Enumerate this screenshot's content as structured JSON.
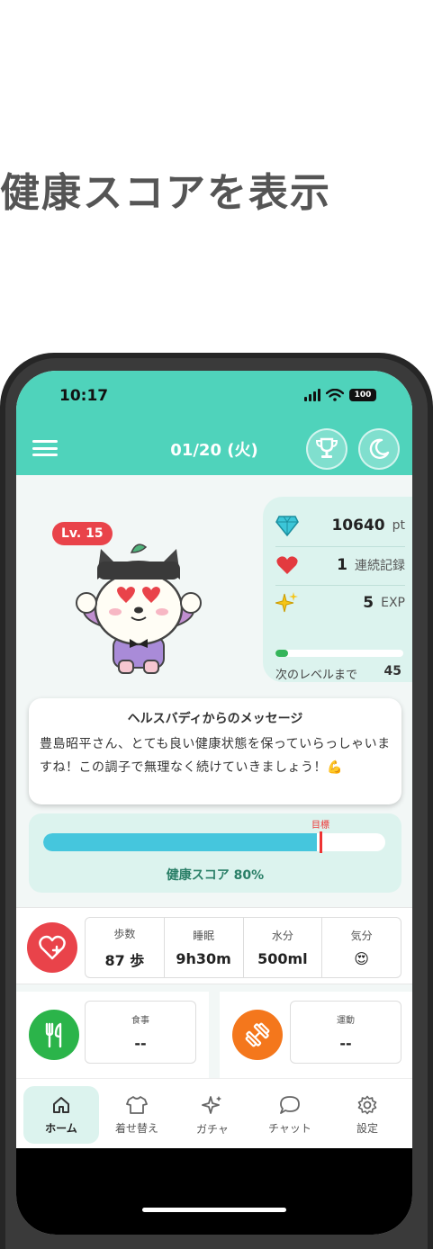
{
  "headline": "健康スコアを表示",
  "status_bar": {
    "time": "10:17",
    "battery": "100"
  },
  "app_bar": {
    "date": "01/20 (火)",
    "icons": [
      "menu-icon",
      "trophy-icon",
      "moon-icon"
    ]
  },
  "character": {
    "level_badge": "Lv. 15"
  },
  "stats": {
    "points": {
      "value": "10640",
      "unit": "pt",
      "icon": "diamond-icon"
    },
    "streak": {
      "value": "1",
      "unit": "連続記録",
      "icon": "heart-icon"
    },
    "exp": {
      "value": "5",
      "unit": "EXP",
      "icon": "sparkle-icon"
    },
    "exp_progress": 0.1,
    "next_level_label": "次のレベルまで",
    "next_level_value": "45"
  },
  "message": {
    "title": "ヘルスバディからのメッセージ",
    "body": "豊島昭平さん、とても良い健康状態を保っていらっしゃいますね！この調子で無理なく続けていきましょう！💪"
  },
  "health_score": {
    "goal_label": "目標",
    "label": "健康スコア 80%",
    "value": 0.8,
    "goal": 0.81
  },
  "vitals": [
    {
      "label": "歩数",
      "value": "87 歩"
    },
    {
      "label": "睡眠",
      "value": "9h30m"
    },
    {
      "label": "水分",
      "value": "500ml"
    },
    {
      "label": "気分",
      "value": "😍"
    }
  ],
  "meal": {
    "label": "食事",
    "value": "--"
  },
  "exercise": {
    "label": "運動",
    "value": "--"
  },
  "tabs": [
    {
      "label": "ホーム",
      "icon": "home-icon"
    },
    {
      "label": "着せ替え",
      "icon": "shirt-icon"
    },
    {
      "label": "ガチャ",
      "icon": "sparkle-icon"
    },
    {
      "label": "チャット",
      "icon": "chat-bubble-icon"
    },
    {
      "label": "設定",
      "icon": "gear-icon"
    }
  ],
  "colors": {
    "primary": "#4fd3bb",
    "accent_red": "#e9434a",
    "score_bar": "#45c6dd",
    "food": "#2bb44a",
    "exercise": "#f4771c"
  }
}
